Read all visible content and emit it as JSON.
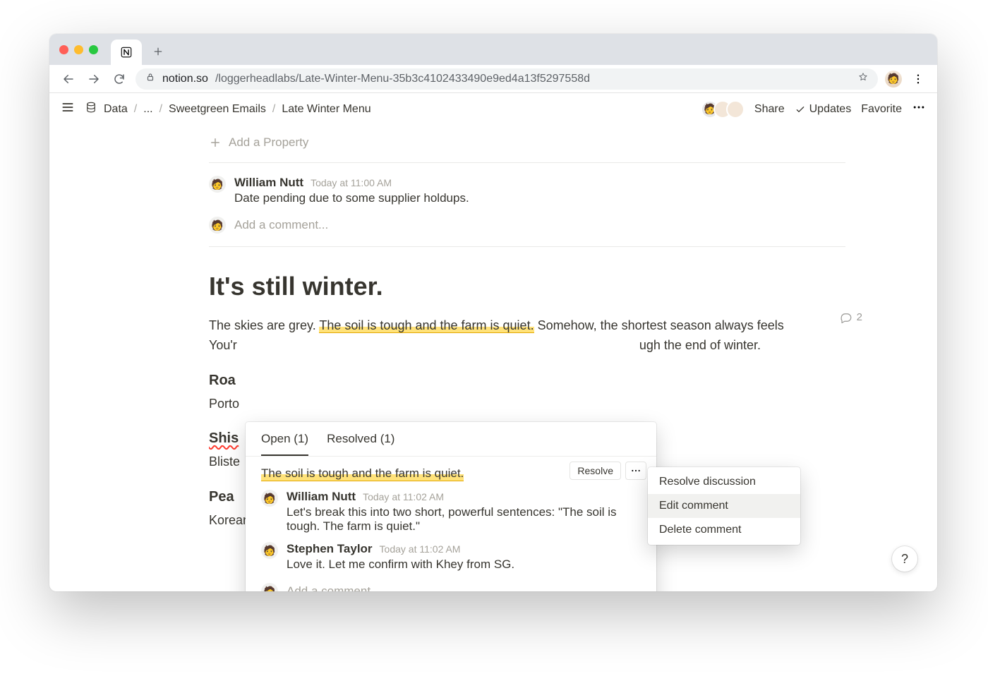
{
  "browser": {
    "url_host": "notion.so",
    "url_path": "/loggerheadlabs/Late-Winter-Menu-35b3c4102433490e9ed4a13f5297558d"
  },
  "breadcrumbs": {
    "root": "Data",
    "ellipsis": "...",
    "parent": "Sweetgreen Emails",
    "current": "Late Winter Menu"
  },
  "topbar": {
    "share": "Share",
    "updates": "Updates",
    "favorite": "Favorite"
  },
  "properties": {
    "add_label": "Add a Property"
  },
  "page_comments": {
    "author": "William Nutt",
    "time": "Today at 11:00 AM",
    "body": "Date pending due to some supplier holdups.",
    "add_placeholder": "Add a comment..."
  },
  "doc": {
    "h1": "It's still winter.",
    "para1_a": "The skies are grey. ",
    "para1_hl": "The soil is tough and the farm is quiet.",
    "para1_b": " Somehow, the shortest season always feels",
    "para2_a": "You'r",
    "para2_b": "ugh the end of winter.",
    "h3a": "Roa",
    "body_a": "Porto",
    "h3b": "Shis",
    "body_b": "Bliste",
    "h3c": "Pea",
    "body_c": "Korean pear, Mama O's kimchi, mustard greens, kimchi vinaigrette.",
    "comment_count": "2"
  },
  "popover": {
    "tab_open": "Open (1)",
    "tab_resolved": "Resolved (1)",
    "quoted": "The soil is tough and the farm is quiet.",
    "resolve": "Resolve",
    "thread": [
      {
        "author": "William Nutt",
        "time": "Today at 11:02 AM",
        "body": "Let's break this into two short, powerful sentences: \"The soil is tough. The farm is quiet.\""
      },
      {
        "author": "Stephen Taylor",
        "time": "Today at 11:02 AM",
        "body": "Love it. Let me confirm with Khey from SG."
      }
    ],
    "add_placeholder": "Add a comment..."
  },
  "ctxmenu": {
    "resolve": "Resolve discussion",
    "edit": "Edit comment",
    "delete": "Delete comment"
  },
  "help": "?"
}
